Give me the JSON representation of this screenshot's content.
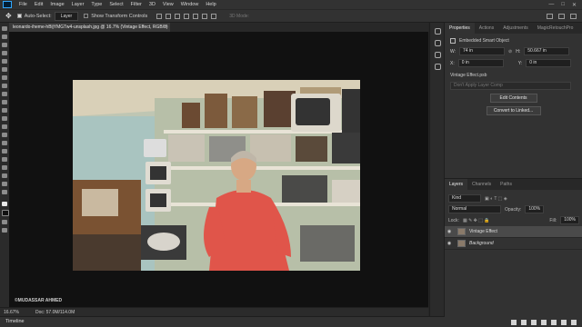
{
  "menu": [
    "File",
    "Edit",
    "Image",
    "Layer",
    "Type",
    "Select",
    "Filter",
    "3D",
    "View",
    "Window",
    "Help"
  ],
  "options_bar": {
    "auto_select_label": "Auto-Select:",
    "auto_select_value": "Layer",
    "transform_label": "Show Transform Controls",
    "mode_3d": "3D Mode:"
  },
  "document_tab": {
    "title": "leonardo-iheme-hBljYMGTw4-unsplash.jpg @ 16.7% (Vintage Effect, RGB/8)",
    "close": "×"
  },
  "watermark": "©MUDASSAR AHMED",
  "status": {
    "zoom": "16.67%",
    "doc": "Doc: 57.0M/114.0M"
  },
  "timeline": {
    "label": "Timeline"
  },
  "properties": {
    "tabs": [
      "Properties",
      "Actions",
      "Adjustments",
      "MagicRetouchPro"
    ],
    "title": "Embedded Smart Object",
    "w_label": "W:",
    "w_value": "74 in",
    "h_label": "H:",
    "h_value": "50.667 in",
    "x_label": "X:",
    "x_value": "0 in",
    "y_label": "Y:",
    "y_value": "0 in",
    "file": "Vintage Effect.psb",
    "layer_comp": "Don't Apply Layer Comp",
    "edit_contents": "Edit Contents",
    "convert_linked": "Convert to Linked..."
  },
  "layers_panel": {
    "tabs": [
      "Layers",
      "Channels",
      "Paths"
    ],
    "kind": "Kind",
    "blend_mode": "Normal",
    "opacity_label": "Opacity:",
    "opacity": "100%",
    "lock_label": "Lock:",
    "fill_label": "Fill:",
    "fill": "100%",
    "layers": [
      {
        "name": "Vintage Effect",
        "selected": true
      },
      {
        "name": "Background",
        "selected": false
      }
    ]
  },
  "colors": {
    "accent": "#31a8ff",
    "panel": "#323232",
    "canvas": "#111111"
  }
}
